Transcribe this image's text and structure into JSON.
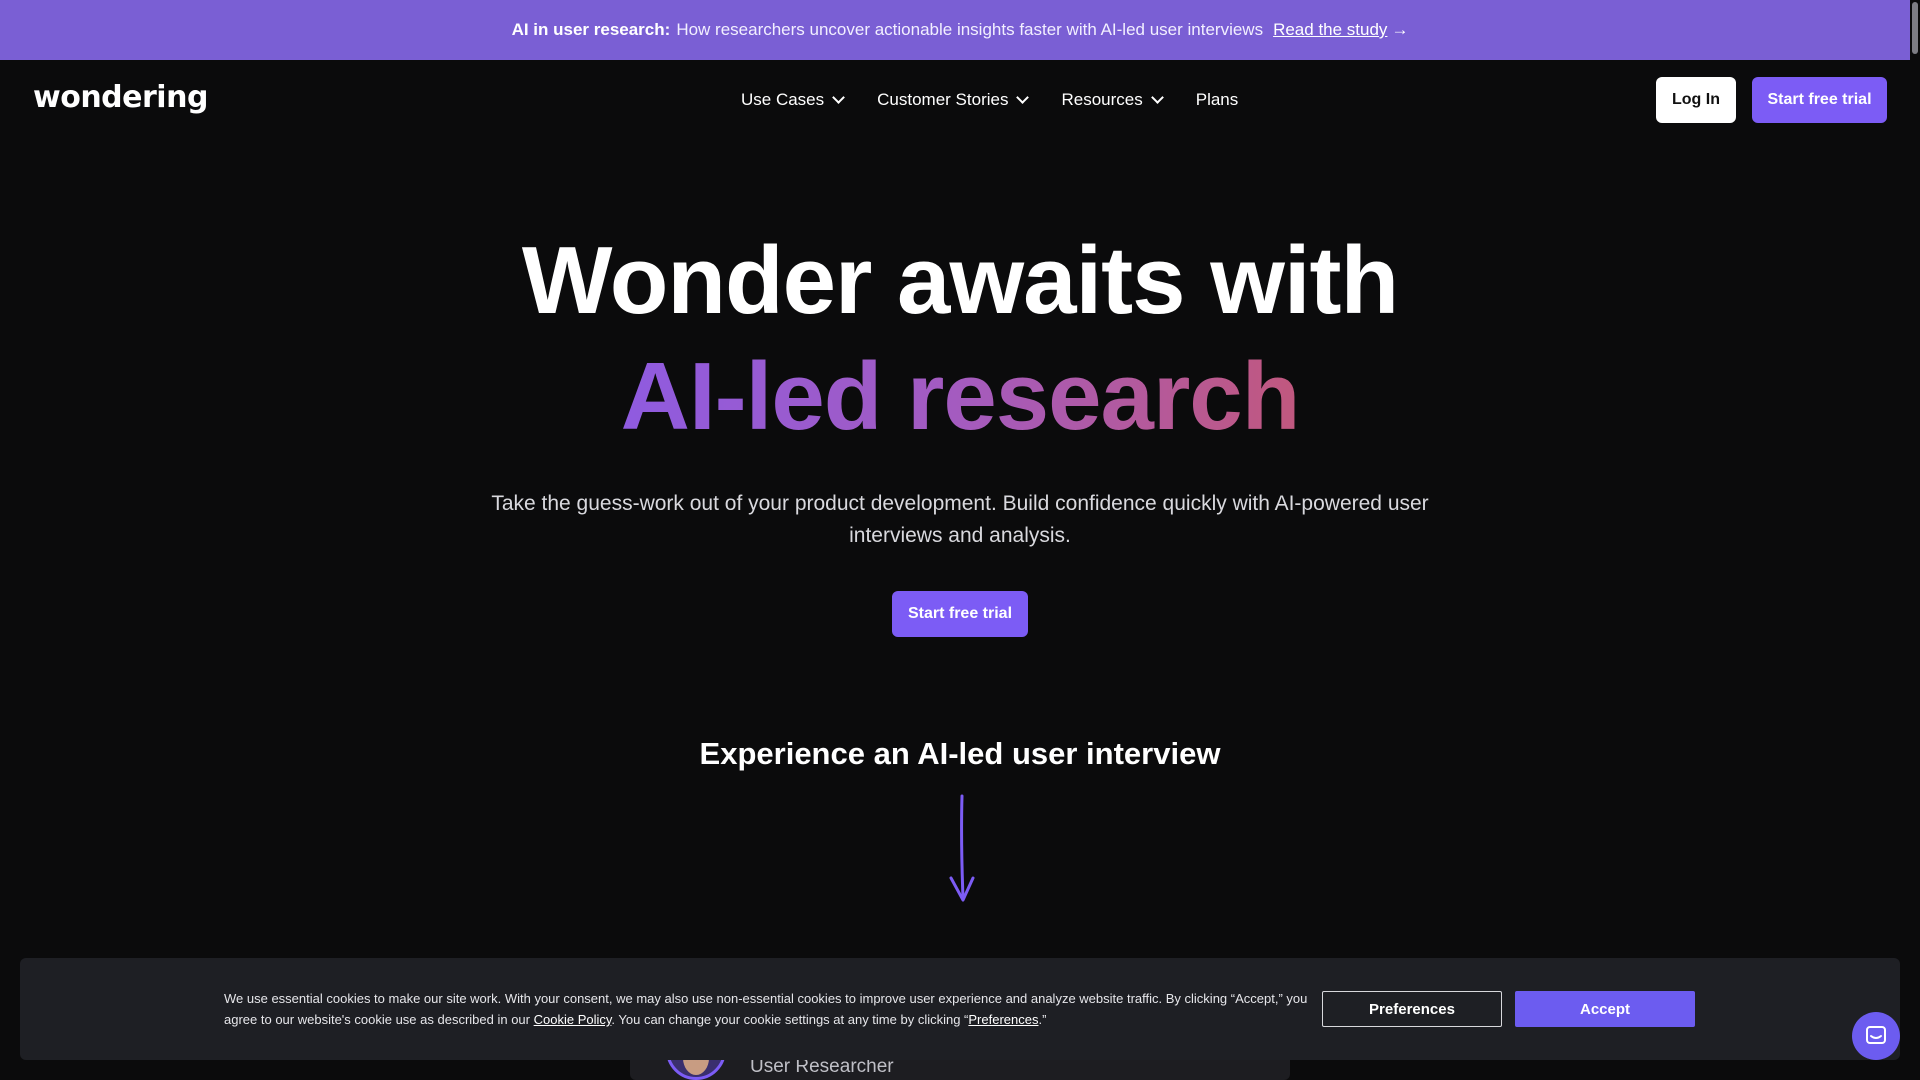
{
  "banner": {
    "lead": "AI in user research:",
    "text": "How researchers uncover actionable insights faster with AI-led user interviews",
    "link": "Read the study",
    "arrow": "→"
  },
  "nav": {
    "logo": "wondering",
    "items": [
      {
        "label": "Use Cases",
        "dropdown": true
      },
      {
        "label": "Customer Stories",
        "dropdown": true
      },
      {
        "label": "Resources",
        "dropdown": true
      },
      {
        "label": "Plans",
        "dropdown": false
      }
    ],
    "login": "Log In",
    "trial": "Start free trial"
  },
  "hero": {
    "line1": "Wonder awaits with",
    "line2": "AI-led research",
    "subtitle": "Take the guess-work out of your product development. Build confidence quickly with AI-powered user interviews and analysis.",
    "cta": "Start free trial",
    "experience": "Experience an AI-led user interview"
  },
  "demo": {
    "role": "User Researcher"
  },
  "cookie": {
    "text_part1": "We use essential cookies to make our site work. With your consent, we may also use non-essential cookies to improve user experience and analyze website traffic. By clicking “Accept,” you agree to our website's cookie use as described in our ",
    "policy_link": "Cookie Policy",
    "text_part2": ". You can change your cookie settings at any time by clicking “",
    "pref_link": "Preferences",
    "text_part3": ".”",
    "preferences": "Preferences",
    "accept": "Accept"
  },
  "colors": {
    "banner": "#7a5fd4",
    "accent": "#7c5cf5",
    "background": "#0b0b0c",
    "gradient_start": "#8f5be0",
    "gradient_end": "#c1587e"
  },
  "icons": {
    "chevron": "chevron-down-icon",
    "arrow": "arrow-down-icon",
    "chat": "chat-icon"
  }
}
